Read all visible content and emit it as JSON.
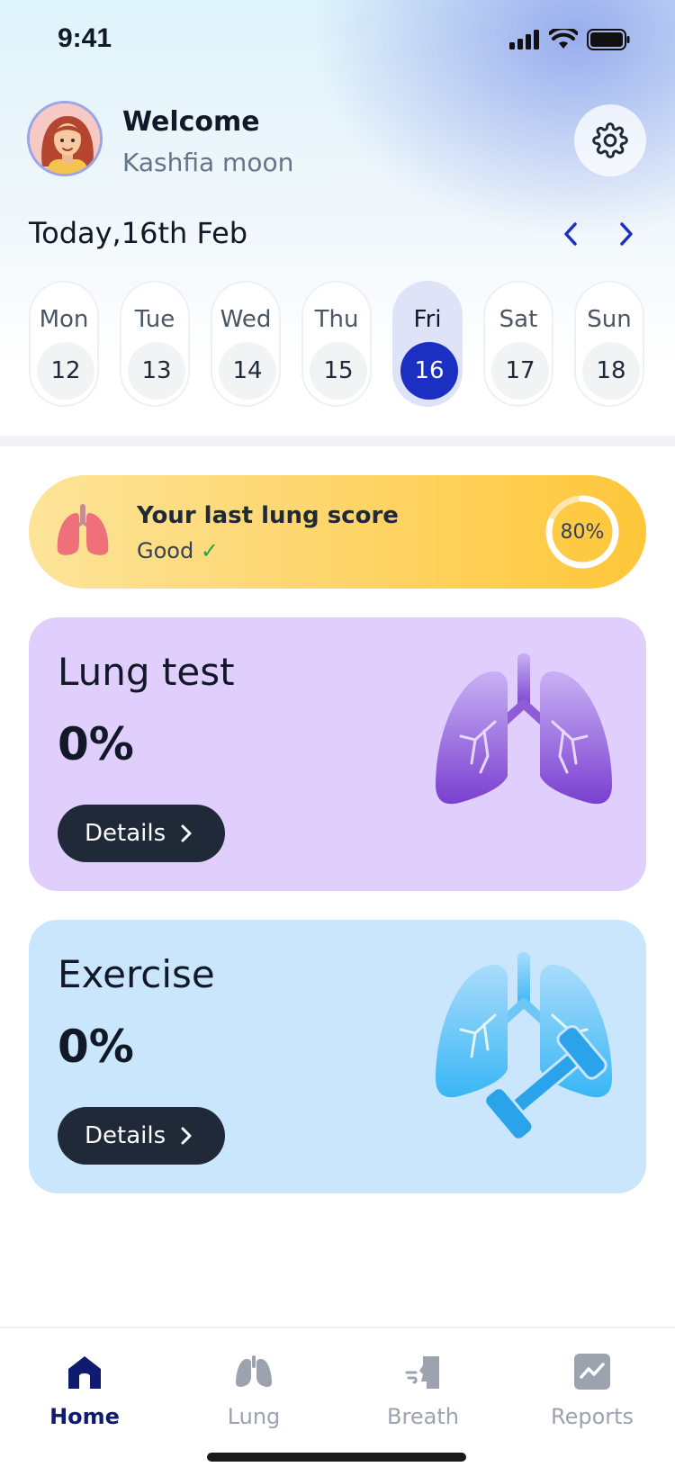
{
  "status_bar": {
    "time": "9:41"
  },
  "header": {
    "greeting": "Welcome",
    "username": "Kashfia moon",
    "date_title": "Today,16th Feb"
  },
  "days": [
    {
      "name": "Mon",
      "num": "12",
      "active": false
    },
    {
      "name": "Tue",
      "num": "13",
      "active": false
    },
    {
      "name": "Wed",
      "num": "14",
      "active": false
    },
    {
      "name": "Thu",
      "num": "15",
      "active": false
    },
    {
      "name": "Fri",
      "num": "16",
      "active": true
    },
    {
      "name": "Sat",
      "num": "17",
      "active": false
    },
    {
      "name": "Sun",
      "num": "18",
      "active": false
    }
  ],
  "score": {
    "title": "Your last lung score",
    "status": "Good",
    "check": "✓",
    "percent_label": "80%",
    "percent": 80
  },
  "cards": {
    "lung": {
      "title": "Lung test",
      "value": "0%",
      "button": "Details"
    },
    "exercise": {
      "title": "Exercise",
      "value": "0%",
      "button": "Details"
    }
  },
  "tabs": [
    {
      "label": "Home",
      "icon": "home-icon",
      "active": true
    },
    {
      "label": "Lung",
      "icon": "lung-icon",
      "active": false
    },
    {
      "label": "Breath",
      "icon": "breath-icon",
      "active": false
    },
    {
      "label": "Reports",
      "icon": "reports-icon",
      "active": false
    }
  ],
  "colors": {
    "accent": "#1b2fc3",
    "score_card": "#fdd56a",
    "lung_card": "#e0cffc",
    "exercise_card": "#c9e6fc",
    "button_dark": "#1f2937",
    "tab_active": "#0f1b6e"
  }
}
